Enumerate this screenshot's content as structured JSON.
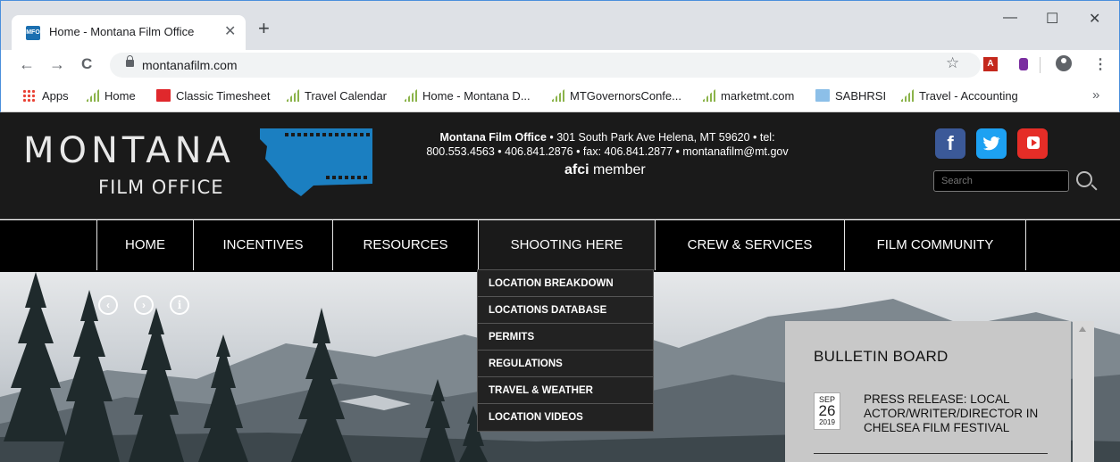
{
  "browser": {
    "tab_title": "Home - Montana Film Office",
    "tab_favicon_text": "MFO",
    "tab_close": "✕",
    "new_tab": "+",
    "url": "montanafilm.com",
    "win_minimize": "—",
    "win_maximize": "☐",
    "win_close": "✕",
    "back": "←",
    "forward": "→",
    "reload": "C",
    "star": "☆",
    "pdf_ext": "A",
    "menu": "⋮",
    "bookmarks_more": "»",
    "bookmarks": [
      {
        "label": "Apps",
        "icon": "apps-icon"
      },
      {
        "label": "Home",
        "icon": "bars-icon"
      },
      {
        "label": "Classic Timesheet",
        "icon": "red-icon"
      },
      {
        "label": "Travel Calendar",
        "icon": "bars-icon"
      },
      {
        "label": "Home - Montana D...",
        "icon": "bars-icon"
      },
      {
        "label": "MTGovernorsConfe...",
        "icon": "bars-icon"
      },
      {
        "label": "marketmt.com",
        "icon": "bars-icon"
      },
      {
        "label": "SABHRSI",
        "icon": "blue-icon"
      },
      {
        "label": "Travel - Accounting",
        "icon": "bars-icon"
      }
    ]
  },
  "header": {
    "logo_title": "MONTANA",
    "logo_subtitle": "FILM OFFICE",
    "contact_name": "Montana Film Office",
    "contact_line1": " • 301 South Park Ave Helena, MT 59620 • tel:",
    "contact_line2": "800.553.4563 • 406.841.2876 • fax: 406.841.2877 • montanafilm@mt.gov",
    "afci_brand": "afci",
    "afci_member": " member",
    "facebook": "f",
    "twitter": "t",
    "search_placeholder": "Search"
  },
  "nav": {
    "items": [
      "HOME",
      "INCENTIVES",
      "RESOURCES",
      "SHOOTING HERE",
      "CREW & SERVICES",
      "FILM COMMUNITY"
    ]
  },
  "hero": {
    "prev": "‹",
    "next": "›",
    "info": "i"
  },
  "dropdown": {
    "items": [
      "LOCATION BREAKDOWN",
      "LOCATIONS DATABASE",
      "PERMITS",
      "REGULATIONS",
      "TRAVEL & WEATHER",
      "LOCATION VIDEOS"
    ]
  },
  "bulletin": {
    "title": "BULLETIN BOARD",
    "post_month": "SEP",
    "post_day": "26",
    "post_year": "2019",
    "post_title": "PRESS RELEASE: LOCAL ACTOR/WRITER/DIRECTOR IN CHELSEA FILM FESTIVAL"
  },
  "colors": {
    "header_bg": "#1a1a1a",
    "nav_bg": "#000000",
    "facebook": "#3b5998",
    "twitter": "#1da1f2",
    "youtube": "#e52d27",
    "logo_map": "#1b7fc1"
  }
}
